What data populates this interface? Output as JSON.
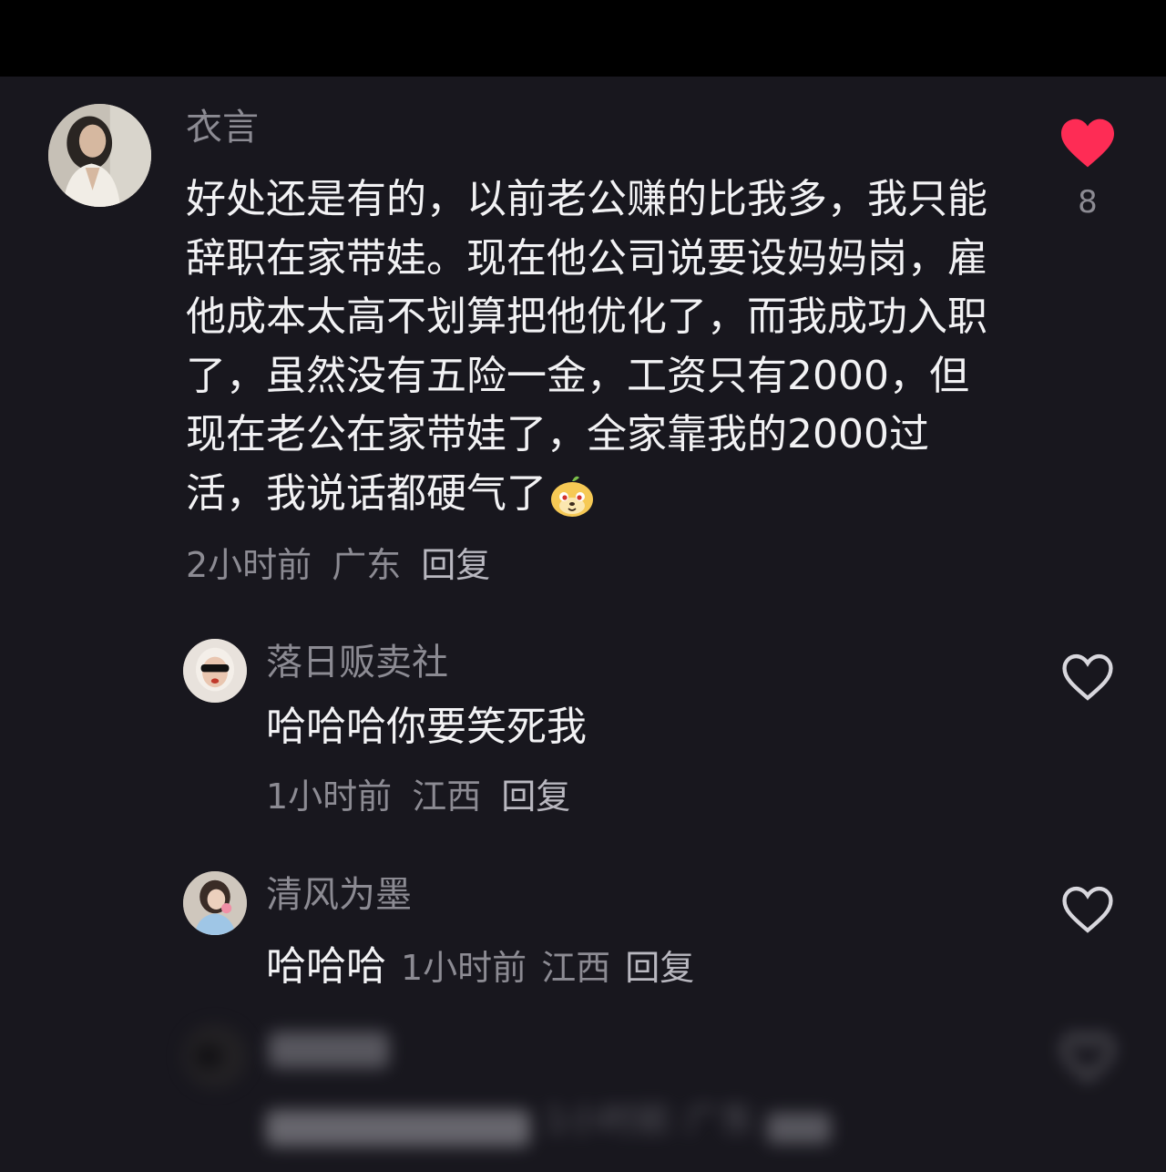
{
  "comments": [
    {
      "username": "衣言",
      "text": "好处还是有的，以前老公赚的比我多，我只能辞职在家带娃。现在他公司说要设妈妈岗，雇他成本太高不划算把他优化了，而我成功入职了，虽然没有五险一金，工资只有2000，但现在老公在家带娃了，全家靠我的2000过活，我说话都硬气了",
      "emoji": "cheeky-dog-emoji",
      "time": "2小时前",
      "location": "广东",
      "reply_label": "回复",
      "likes": "8",
      "liked": true
    }
  ],
  "replies": [
    {
      "username": "落日贩卖社",
      "text": "哈哈哈你要笑死我",
      "time": "1小时前",
      "location": "江西",
      "reply_label": "回复",
      "liked": false
    },
    {
      "username": "清风为墨",
      "text": "哈哈哈",
      "time": "1小时前",
      "location": "江西",
      "reply_label": "回复",
      "liked": false
    },
    {
      "username": "",
      "text": "",
      "time": "1小时前",
      "location": "广东",
      "reply_label": "",
      "liked": false
    }
  ],
  "colors": {
    "background": "#18171e",
    "like_red": "#fe2c55",
    "secondary_text": "#8c8b93",
    "primary_text": "#f2f2f4"
  }
}
